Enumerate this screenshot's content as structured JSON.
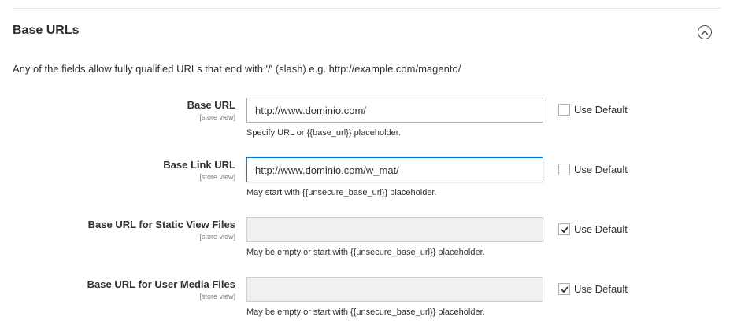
{
  "section": {
    "title": "Base URLs",
    "toggle_icon": "chevron-up-circle-icon",
    "comment": "Any of the fields allow fully qualified URLs that end with '/' (slash) e.g. http://example.com/magento/"
  },
  "fields": [
    {
      "label": "Base URL",
      "scope": "[store view]",
      "value": "http://www.dominio.com/",
      "note": "Specify URL or {{base_url}} placeholder.",
      "use_default_label": "Use Default",
      "use_default_checked": false,
      "disabled": false,
      "focused": false
    },
    {
      "label": "Base Link URL",
      "scope": "[store view]",
      "value": "http://www.dominio.com/w_mat/",
      "note": "May start with {{unsecure_base_url}} placeholder.",
      "use_default_label": "Use Default",
      "use_default_checked": false,
      "disabled": false,
      "focused": true
    },
    {
      "label": "Base URL for Static View Files",
      "scope": "[store view]",
      "value": "",
      "note": "May be empty or start with {{unsecure_base_url}} placeholder.",
      "use_default_label": "Use Default",
      "use_default_checked": true,
      "disabled": true,
      "focused": false
    },
    {
      "label": "Base URL for User Media Files",
      "scope": "[store view]",
      "value": "",
      "note": "May be empty or start with {{unsecure_base_url}} placeholder.",
      "use_default_label": "Use Default",
      "use_default_checked": true,
      "disabled": true,
      "focused": false
    }
  ],
  "colors": {
    "focus_border": "#007bdb",
    "disabled_bg": "#f0f0f0",
    "text": "#303030"
  }
}
